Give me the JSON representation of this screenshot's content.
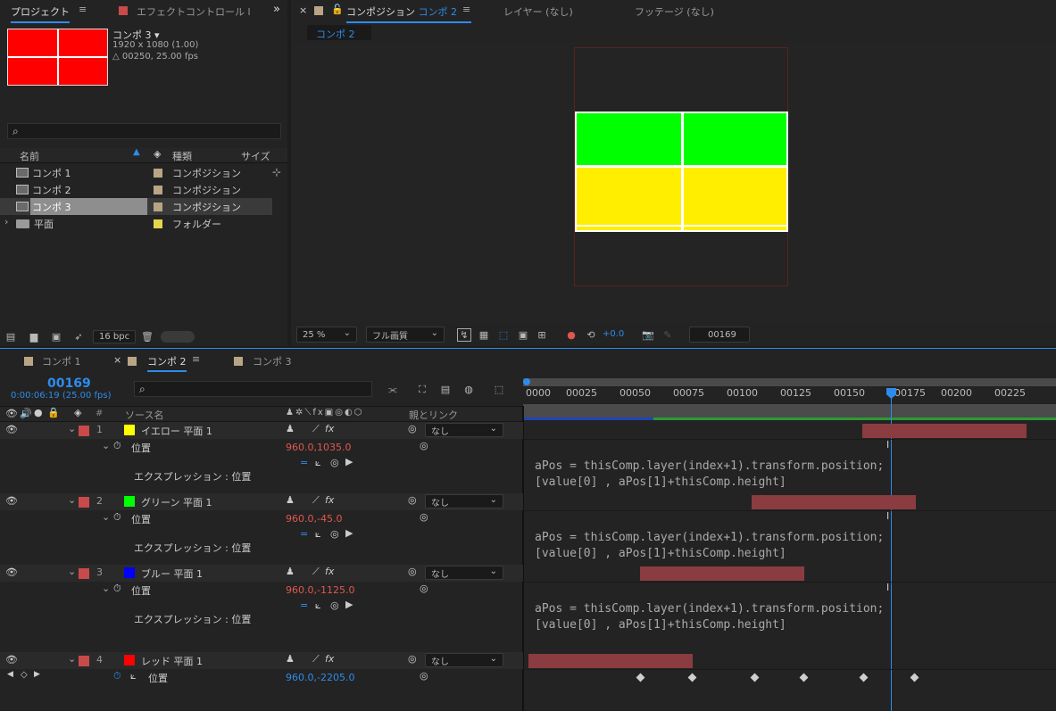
{
  "project_panel": {
    "tab_project": "プロジェクト",
    "tab_effect": "エフェクトコントロール l",
    "comp_name": "コンポ 3 ▾",
    "comp_size": "1920 x 1080 (1.00)",
    "comp_duration": "△ 00250, 25.00 fps",
    "search_placeholder": "",
    "col_name": "名前",
    "col_type": "種類",
    "col_size": "サイズ",
    "items": [
      {
        "name": "コンポ 1",
        "type": "コンポジション"
      },
      {
        "name": "コンポ 2",
        "type": "コンポジション"
      },
      {
        "name": "コンポ 3",
        "type": "コンポジション"
      },
      {
        "name": "平面",
        "type": "フォルダー"
      }
    ],
    "bpc": "16 bpc"
  },
  "viewer": {
    "tab_comp_prefix": "コンポジション",
    "tab_comp_name": "コンポ 2",
    "tab_layer": "レイヤー (なし)",
    "tab_footage": "フッテージ (なし)",
    "breadcrumb": "コンポ 2",
    "zoom": "25 %",
    "quality": "フル画質",
    "exposure": "+0.0",
    "frame": "00169"
  },
  "timeline": {
    "tabs": [
      "コンポ 1",
      "コンポ 2",
      "コンポ 3"
    ],
    "current_frame": "00169",
    "current_time": "0:00:06:19 (25.00 fps)",
    "col_source": "ソース名",
    "col_parent": "親とリンク",
    "col_num": "#",
    "ruler_ticks": [
      "0000",
      "00025",
      "00050",
      "00075",
      "00100",
      "00125",
      "00150",
      "00175",
      "00200",
      "00225"
    ],
    "parent_none": "なし",
    "prop_position": "位置",
    "expr_label": "エクスプレッション : 位置",
    "expr_line1": "aPos = thisComp.layer(index+1).transform.position;",
    "expr_line2": "[value[0] , aPos[1]+thisComp.height]",
    "layers": [
      {
        "num": "1",
        "name": "イエロー 平面 1",
        "color": "#ffff00",
        "pos": "960.0,1035.0"
      },
      {
        "num": "2",
        "name": "グリーン 平面 1",
        "color": "#00ff00",
        "pos": "960.0,-45.0"
      },
      {
        "num": "3",
        "name": "ブルー 平面 1",
        "color": "#0000ff",
        "pos": "960.0,-1125.0"
      },
      {
        "num": "4",
        "name": "レッド 平面 1",
        "color": "#ff0000",
        "pos": "960.0,-2205.0"
      }
    ]
  },
  "colors": {
    "accent": "#2d8ceb",
    "label_red": "#c94a4a",
    "bar": "#8a3c40"
  }
}
